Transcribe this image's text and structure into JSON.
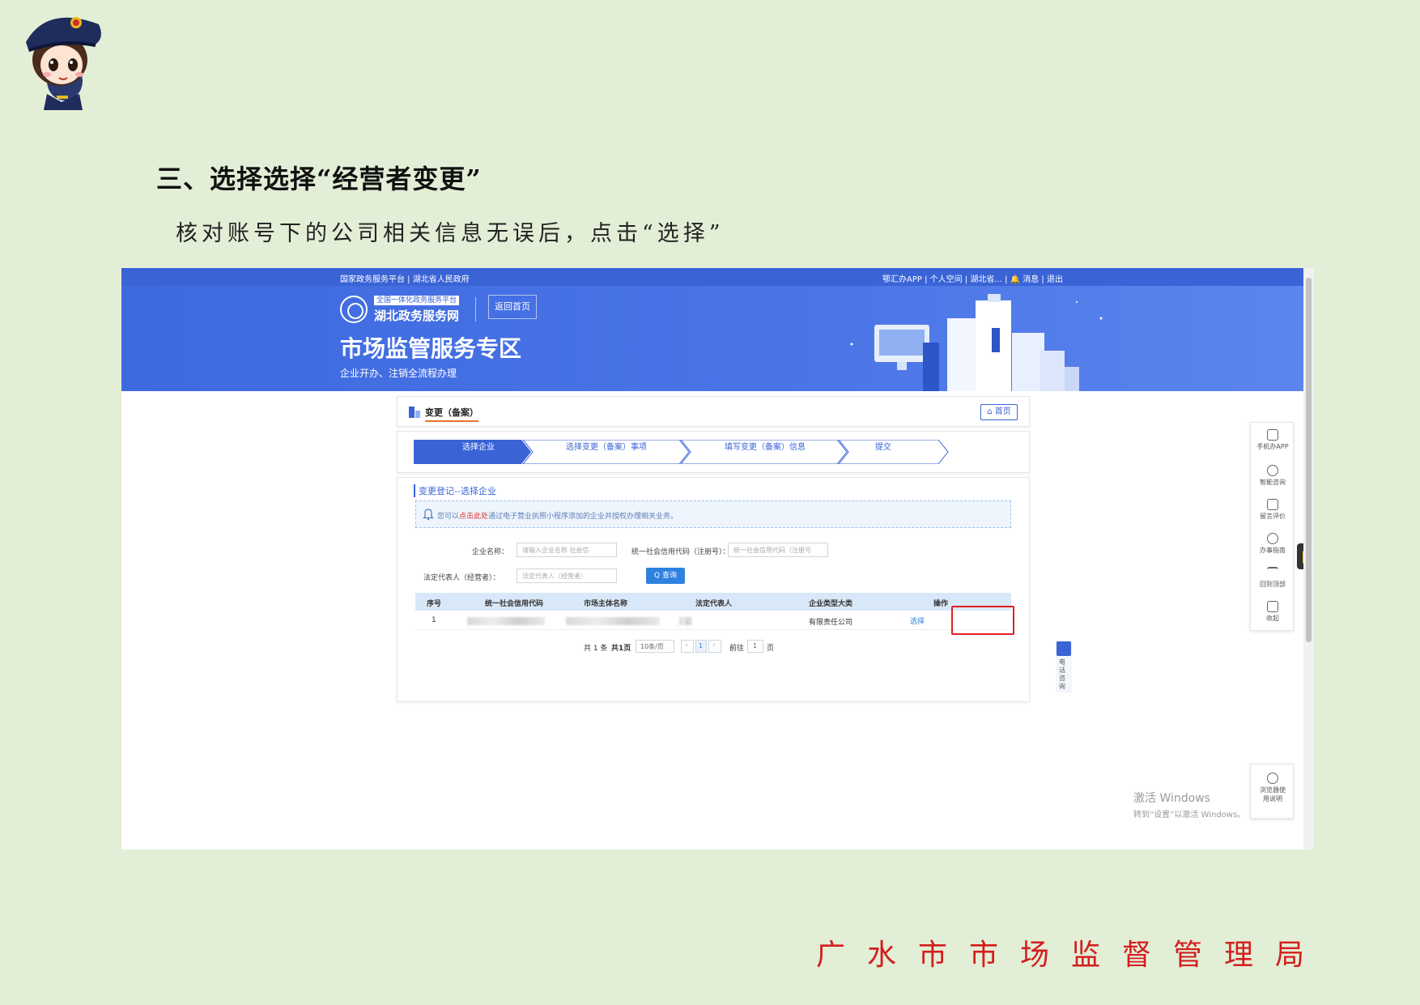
{
  "doc": {
    "heading": "三、选择选择“经营者变更”",
    "instruction": "核对账号下的公司相关信息无误后，点击“选择”",
    "footer_org": "广水市市场监督管理局"
  },
  "screenshot": {
    "topbar": {
      "left": "国家政务服务平台 | 湖北省人民政府",
      "right": "鄂汇办APP | 个人空间 | 湖北省... | 🔔 消息 | 退出"
    },
    "banner": {
      "logo_sub": "全国一体化政务服务平台",
      "logo_name": "湖北政务服务网",
      "home_btn": "返回首页",
      "zone_title": "市场监管服务专区",
      "zone_sub": "企业开办、注销全流程办理"
    },
    "page_header": {
      "title": "变更（备案）",
      "home_btn": "首页"
    },
    "steps": [
      "选择企业",
      "选择变更（备案）事项",
      "填写变更（备案）信息",
      "提交"
    ],
    "section_title": "变更登记--选择企业",
    "notice": {
      "pre": "您可以",
      "highlight": "点击此处",
      "post": "通过电子营业执照小程序添加的企业并授权办理相关业务。"
    },
    "form": {
      "company_label": "企业名称：",
      "company_placeholder": "请输入企业名称 社会信",
      "credit_label": "统一社会信用代码（注册号）：",
      "credit_placeholder": "统一社会信用代码（注册号",
      "rep_label": "法定代表人（经营者）：",
      "rep_placeholder": "法定代表人（经营者）",
      "query_btn": "Q 查询"
    },
    "table": {
      "headers": [
        "序号",
        "统一社会信用代码",
        "市场主体名称",
        "法定代表人",
        "企业类型大类",
        "操作"
      ],
      "rows": [
        {
          "index": "1",
          "type": "有限责任公司",
          "action": "选择"
        }
      ]
    },
    "pager": {
      "total": "共 1 条",
      "pages": "共1页",
      "size": "10条/页",
      "current": "1",
      "goto": "前往",
      "goto_value": "1",
      "page_unit": "页"
    },
    "sidebar": [
      "手机办APP",
      "智能咨询",
      "留言评价",
      "办事指南",
      "回到顶部",
      "收起"
    ],
    "phone_float": "电话咨询",
    "guide": "浏览器使用说明",
    "watermark": {
      "line1": "激活 Windows",
      "line2": "转到“设置”以激活 Windows。"
    }
  }
}
